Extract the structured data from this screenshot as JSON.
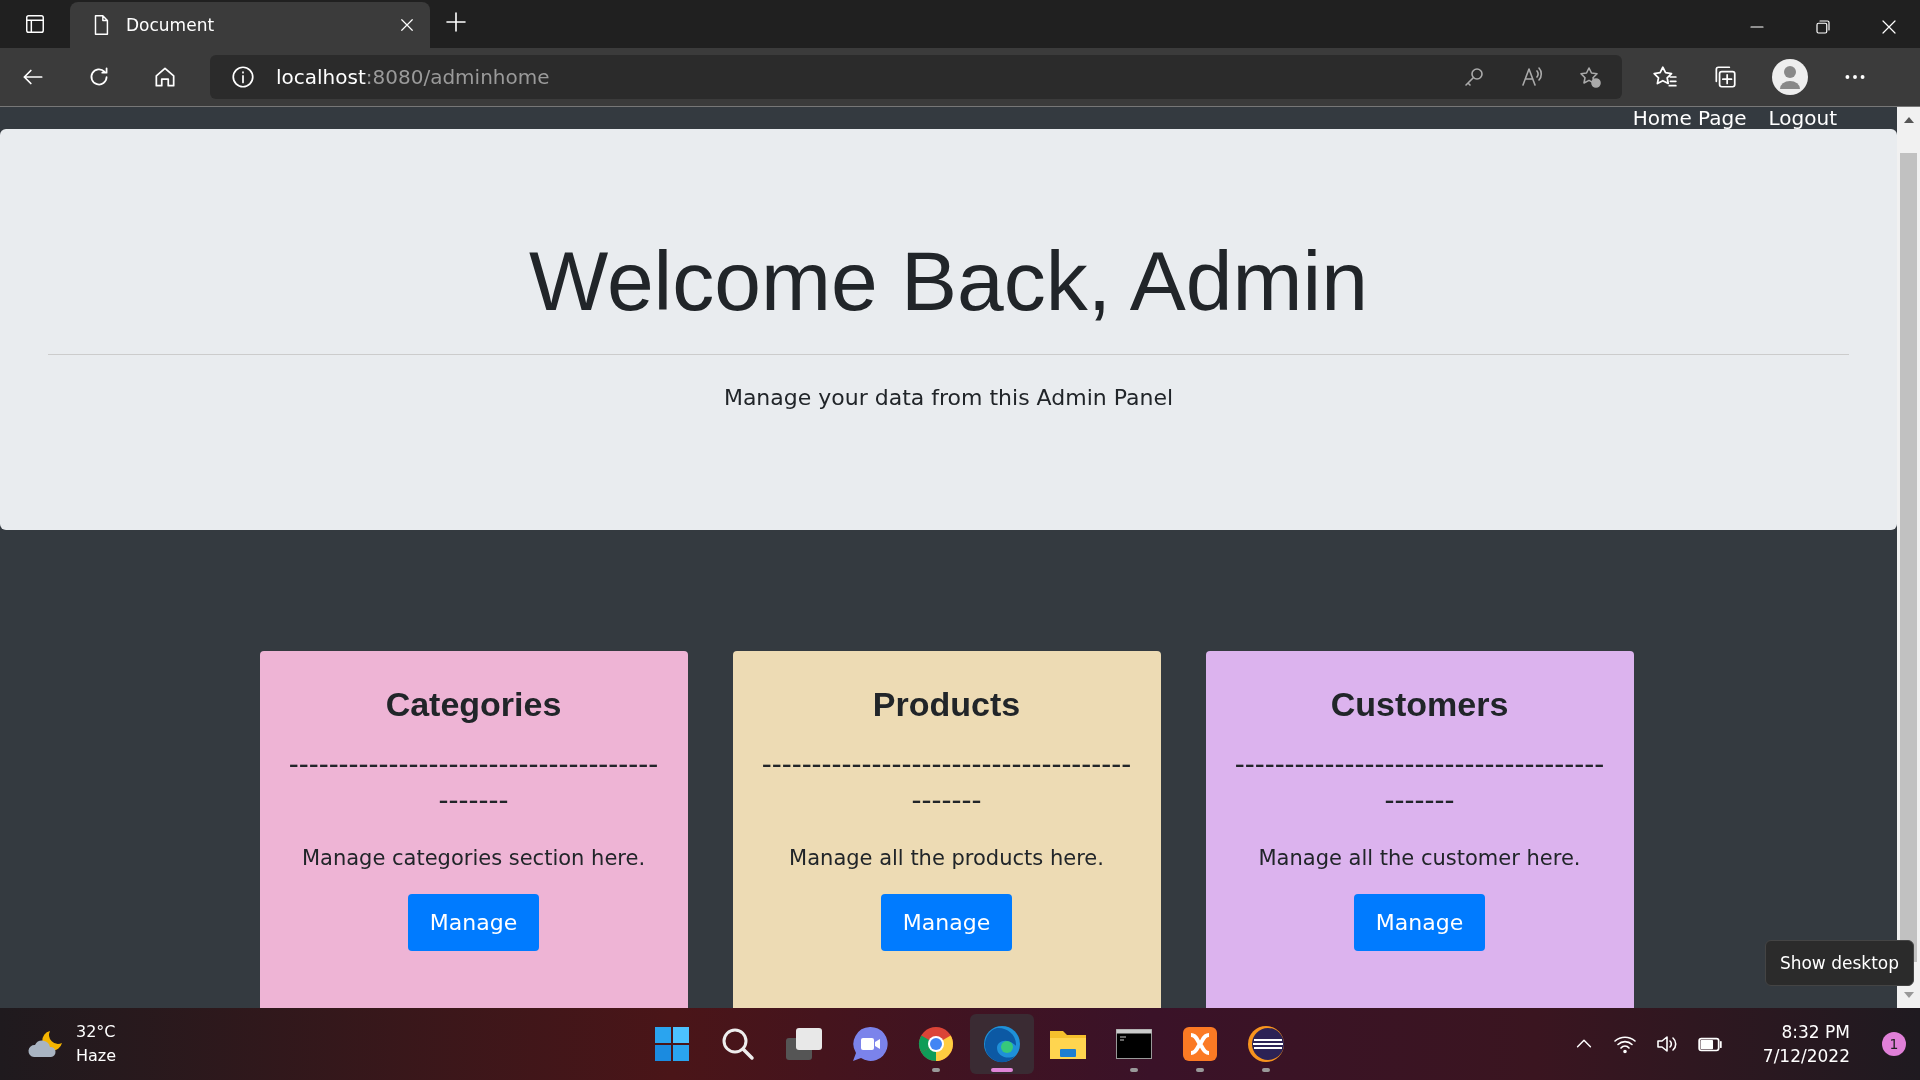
{
  "browser": {
    "tabs": [
      {
        "title": "Document",
        "selected": true
      }
    ],
    "address": {
      "host": "localhost",
      "path": ":8080/adminhome"
    }
  },
  "nav": [
    {
      "label": "Home Page"
    },
    {
      "label": "Logout"
    }
  ],
  "hero": {
    "title": "Welcome Back, Admin",
    "lead": "Manage your data from this Admin Panel"
  },
  "cards": [
    {
      "title": "Categories",
      "divider": "--------------------------------------------",
      "text": "Manage categories section here.",
      "button": "Manage",
      "color": "#eeb4d5"
    },
    {
      "title": "Products",
      "divider": "--------------------------------------------",
      "text": "Manage all the products here.",
      "button": "Manage",
      "color": "#eddbb4"
    },
    {
      "title": "Customers",
      "divider": "--------------------------------------------",
      "text": "Manage all the customer here.",
      "button": "Manage",
      "color": "#dcb3ee"
    }
  ],
  "tooltip": "Show desktop",
  "taskbar": {
    "weather": {
      "temp": "32°C",
      "condition": "Haze"
    },
    "apps": [
      {
        "kind": "start",
        "running": false,
        "selected": false
      },
      {
        "kind": "search",
        "running": false,
        "selected": false
      },
      {
        "kind": "taskview",
        "running": false,
        "selected": false
      },
      {
        "kind": "chat",
        "running": false,
        "selected": false
      },
      {
        "kind": "chrome",
        "running": true,
        "selected": false
      },
      {
        "kind": "edge",
        "running": true,
        "selected": true
      },
      {
        "kind": "folder",
        "running": false,
        "selected": false
      },
      {
        "kind": "terminal",
        "running": true,
        "selected": false
      },
      {
        "kind": "xampp",
        "running": true,
        "selected": false
      },
      {
        "kind": "eclipse",
        "running": true,
        "selected": false
      }
    ],
    "time": "8:32 PM",
    "date": "7/12/2022",
    "notifications": "1"
  }
}
